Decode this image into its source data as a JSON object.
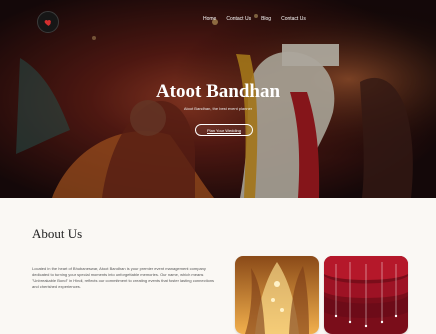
{
  "nav": {
    "items": [
      {
        "label": "Home"
      },
      {
        "label": "Contact Us"
      },
      {
        "label": "Blog"
      },
      {
        "label": "Contact Us"
      }
    ]
  },
  "hero": {
    "title": "Atoot Bandhan",
    "subtitle": "Atoot Bandhan, the best event planner",
    "cta_label": "Plan Your Wedding"
  },
  "about": {
    "title": "About Us",
    "body": "Located in the heart of Bhubaneswar, Atoot Bandhan is your premier event management company dedicated to turning your special moments into unforgettable memories. Our name, which means \"Unbreakable Bond\" in Hindi, reflects our commitment to creating events that foster lasting connections and cherished experiences."
  },
  "colors": {
    "page_bg": "#faf8f4",
    "hero_overlay": "#000000",
    "text_dark": "#222222",
    "text_muted": "#555555",
    "logo_accent": "#d32f2f"
  },
  "icons": {
    "logo": "heart-icon"
  }
}
